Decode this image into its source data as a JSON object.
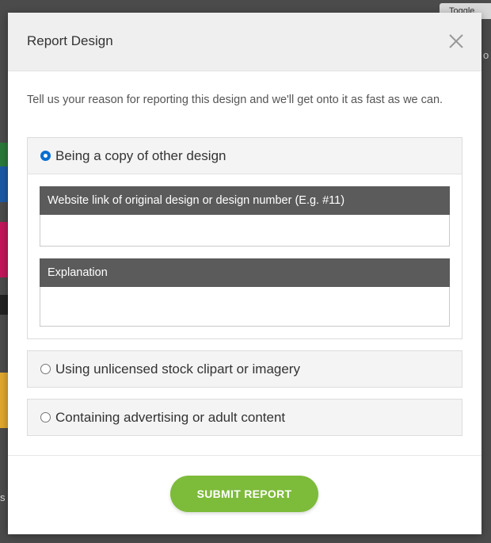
{
  "background": {
    "top_tab": "Toggle",
    "side_text": "s",
    "right_text": "o"
  },
  "modal": {
    "title": "Report Design",
    "close_icon": "close-icon",
    "intro": "Tell us your reason for reporting this design and we'll get onto it as fast as we can.",
    "options": [
      {
        "label": "Being a copy of other design",
        "selected": true,
        "fields": [
          {
            "label": "Website link of original design or design number (E.g. #11)",
            "value": ""
          },
          {
            "label": "Explanation",
            "value": ""
          }
        ]
      },
      {
        "label": "Using unlicensed stock clipart or imagery",
        "selected": false
      },
      {
        "label": "Containing advertising or adult content",
        "selected": false
      }
    ],
    "submit_label": "SUBMIT REPORT"
  },
  "colors": {
    "accent": "#7dbb3a",
    "field_header": "#5b5b5b",
    "radio_selected": "#0a6ed1"
  }
}
